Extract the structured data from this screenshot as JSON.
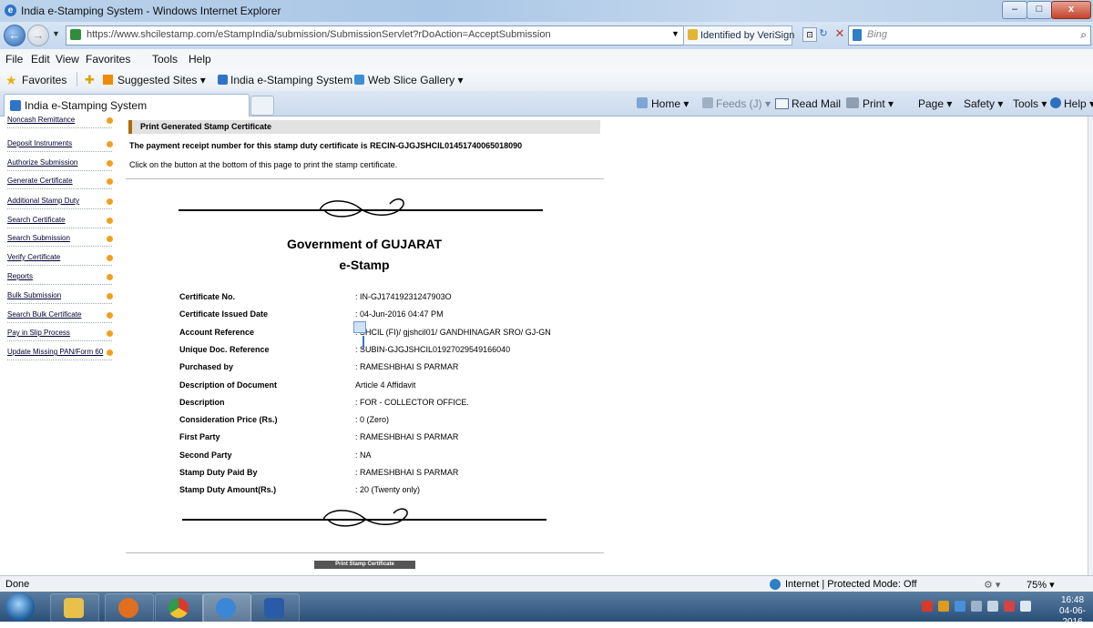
{
  "window": {
    "title": "India e-Stamping System - Windows Internet Explorer",
    "minimize": "–",
    "maximize": "□",
    "close": "x"
  },
  "addressbar": {
    "back": "←",
    "forward": "→",
    "dropdown": "▼",
    "url": "https://www.shcilestamp.com/eStampIndia/submission/SubmissionServlet?rDoAction=AcceptSubmission",
    "identity": "Identified by VeriSign",
    "compat": "⊡",
    "refresh": "↻",
    "stop": "✕",
    "search_placeholder": "Bing",
    "search_glyph": "⌕"
  },
  "menu": [
    "File",
    "Edit",
    "View",
    "Favorites",
    "Tools",
    "Help"
  ],
  "favorites": {
    "favorites_label": "Favorites",
    "suggested": "Suggested Sites ▾",
    "estamp": "India e-Stamping System",
    "webslice": "Web Slice Gallery ▾"
  },
  "tab": {
    "label": "India e-Stamping System"
  },
  "commands": {
    "home": "Home ▾",
    "feeds": "Feeds (J) ▾",
    "readmail": "Read Mail",
    "print": "Print ▾",
    "page": "Page ▾",
    "safety": "Safety ▾",
    "tools": "Tools ▾",
    "help": "Help ▾"
  },
  "sidebar": {
    "items": [
      "Noncash Remittance",
      "Deposit Instruments",
      "Authorize Submission",
      "Generate Certificate",
      "Additional Stamp Duty",
      "Search Certificate",
      "Search Submission",
      "Verify Certificate",
      "Reports",
      "Bulk Submission",
      "Search Bulk Certificate",
      "Pay in Slip Process",
      "Update Missing PAN/Form 60"
    ]
  },
  "certificate": {
    "header": "Print Generated Stamp Certificate",
    "receipt_line": "The payment receipt number for this stamp duty certificate is  RECIN-GJGJSHCIL01451740065018090",
    "instruction": "Click on the button at the bottom of this page to print the stamp certificate.",
    "government": "Government of GUJARAT",
    "estamp": "e-Stamp",
    "rows": [
      {
        "label": "Certificate No.",
        "value": ": IN-GJ17419231247903O"
      },
      {
        "label": "Certificate Issued Date",
        "value": ": 04-Jun-2016 04:47 PM"
      },
      {
        "label": "Account Reference",
        "value": ": SHCIL (FI)/ gjshcil01/ GANDHINAGAR SRO/ GJ-GN"
      },
      {
        "label": "Unique Doc. Reference",
        "value": ": SUBIN-GJGJSHCIL01927029549166040"
      },
      {
        "label": "Purchased by",
        "value": ": RAMESHBHAI S PARMAR"
      },
      {
        "label": "Description of Document",
        "value": "Article 4 Affidavit"
      },
      {
        "label": "Description",
        "value": ": FOR - COLLECTOR OFFICE."
      },
      {
        "label": "Consideration Price (Rs.)",
        "value": ": 0 (Zero)"
      },
      {
        "label": "First Party",
        "value": ": RAMESHBHAI S PARMAR"
      },
      {
        "label": "Second Party",
        "value": ": NA"
      },
      {
        "label": "Stamp Duty Paid By",
        "value": ": RAMESHBHAI S PARMAR"
      },
      {
        "label": "Stamp Duty Amount(Rs.)",
        "value": ": 20 (Twenty only)"
      }
    ],
    "print_button": "Print Stamp Certificate"
  },
  "status": {
    "done": "Done",
    "zone": "Internet | Protected Mode: Off",
    "addon": "⚙ ▾",
    "zoom": "75%  ▾"
  },
  "taskbar": {
    "time": "16:48",
    "date": "04-06-2016"
  }
}
